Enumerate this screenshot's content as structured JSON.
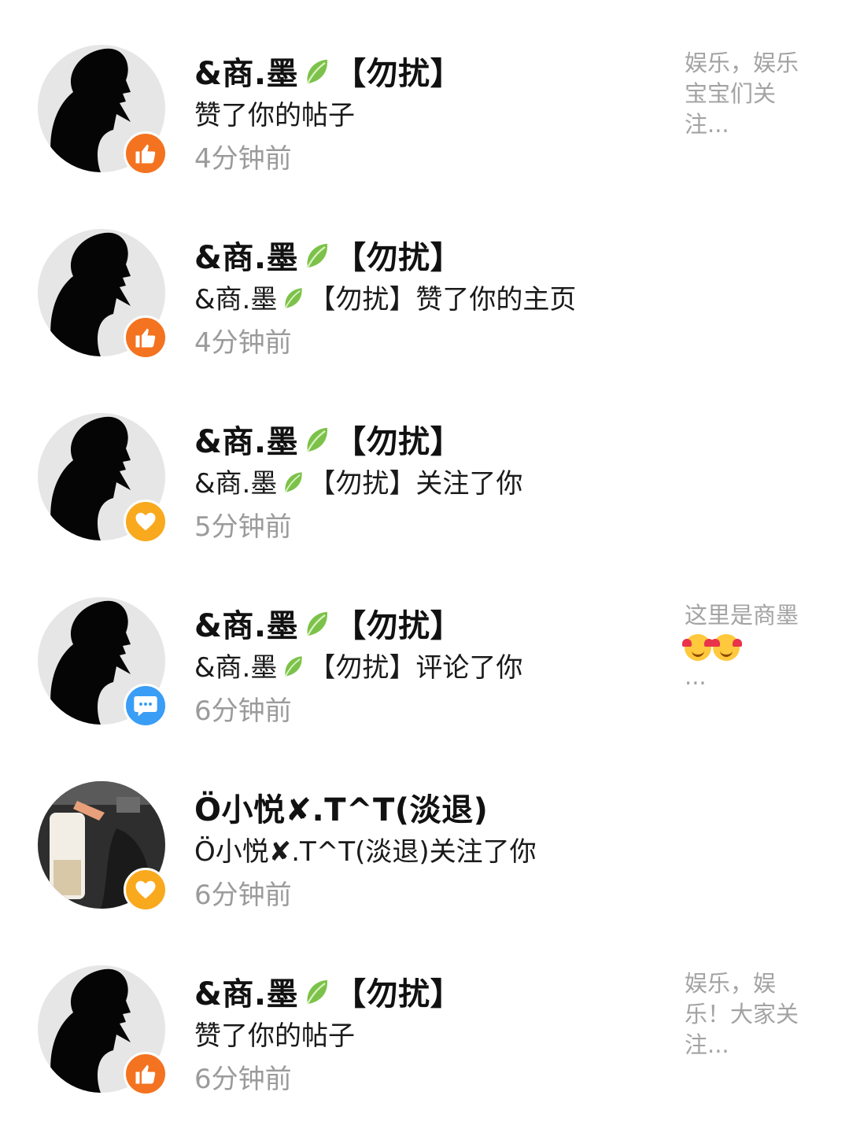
{
  "icons": {
    "like": "thumbs-up-icon",
    "follow": "heart-icon",
    "comment": "speech-bubble-icon",
    "leaf": "leaf-emoji",
    "smile": "smiling-face-with-hearts-emoji"
  },
  "colors": {
    "like": "#f47320",
    "follow": "#f9a91d",
    "comment": "#3a9df6",
    "time": "#9b9b9b",
    "preview": "#a3a3a3"
  },
  "notifications": [
    {
      "name_a": "&商.墨",
      "name_b": "【勿扰】",
      "action": "赞了你的帖子",
      "time": "4分钟前",
      "preview": "娱乐，娱乐宝宝们关注..."
    },
    {
      "name_a": "&商.墨",
      "name_b": "【勿扰】",
      "action_a": "&商.墨",
      "action_b": "【勿扰】赞了你的主页",
      "time": "4分钟前"
    },
    {
      "name_a": "&商.墨",
      "name_b": "【勿扰】",
      "action_a": "&商.墨",
      "action_b": "【勿扰】关注了你",
      "time": "5分钟前"
    },
    {
      "name_a": "&商.墨",
      "name_b": "【勿扰】",
      "action_a": "&商.墨",
      "action_b": "【勿扰】评论了你",
      "time": "6分钟前",
      "preview_a": "这里是商墨",
      "preview_b": "..."
    },
    {
      "name": "Ö小悦✘.T^T(淡退)",
      "action": "Ö小悦✘.T^T(淡退)关注了你",
      "time": "6分钟前"
    },
    {
      "name_a": "&商.墨",
      "name_b": "【勿扰】",
      "action": "赞了你的帖子",
      "time": "6分钟前",
      "preview": "娱乐，娱乐！大家关注..."
    }
  ]
}
